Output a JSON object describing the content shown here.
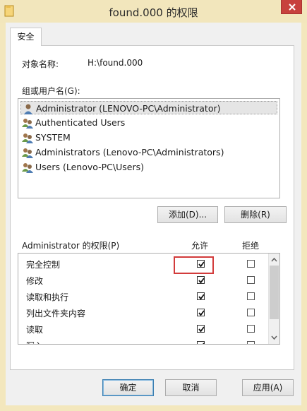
{
  "window": {
    "title": "found.000 的权限"
  },
  "tabs": [
    {
      "label": "安全"
    }
  ],
  "object": {
    "label": "对象名称:",
    "value": "H:\\found.000"
  },
  "groups": {
    "label": "组或用户名(G):",
    "items": [
      {
        "label": "Administrator (LENOVO-PC\\Administrator)",
        "icon": "user-icon",
        "selected": true
      },
      {
        "label": "Authenticated Users",
        "icon": "users-icon"
      },
      {
        "label": "SYSTEM",
        "icon": "users-icon"
      },
      {
        "label": "Administrators (Lenovo-PC\\Administrators)",
        "icon": "users-icon"
      },
      {
        "label": "Users (Lenovo-PC\\Users)",
        "icon": "users-icon"
      }
    ]
  },
  "buttons": {
    "add": "添加(D)...",
    "remove": "删除(R)",
    "ok": "确定",
    "cancel": "取消",
    "apply": "应用(A)"
  },
  "permissions": {
    "label": "Administrator 的权限(P)",
    "allow_header": "允许",
    "deny_header": "拒绝",
    "rows": [
      {
        "name": "完全控制",
        "allow": true,
        "deny": false
      },
      {
        "name": "修改",
        "allow": true,
        "deny": false
      },
      {
        "name": "读取和执行",
        "allow": true,
        "deny": false
      },
      {
        "name": "列出文件夹内容",
        "allow": true,
        "deny": false
      },
      {
        "name": "读取",
        "allow": true,
        "deny": false
      },
      {
        "name": "写入",
        "allow": true,
        "deny": false
      }
    ]
  },
  "colors": {
    "title_bar": "#f2e6bc",
    "close_button": "#c7413d",
    "highlight": "#d23b3b"
  }
}
